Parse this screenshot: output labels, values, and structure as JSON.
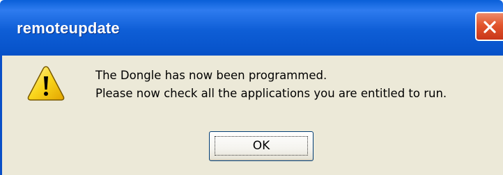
{
  "window": {
    "title": "remoteupdate",
    "close_icon": "close-icon"
  },
  "message": {
    "line1": "The Dongle has now been programmed.",
    "line2": "Please now check all the applications you are entitled to run."
  },
  "icon": "warning-icon",
  "ok_label": "OK",
  "colors": {
    "titlebar": "#0a5fd8",
    "client_bg": "#ece9d8",
    "close_button": "#e2552c",
    "warning_fill": "#f9d51b"
  }
}
